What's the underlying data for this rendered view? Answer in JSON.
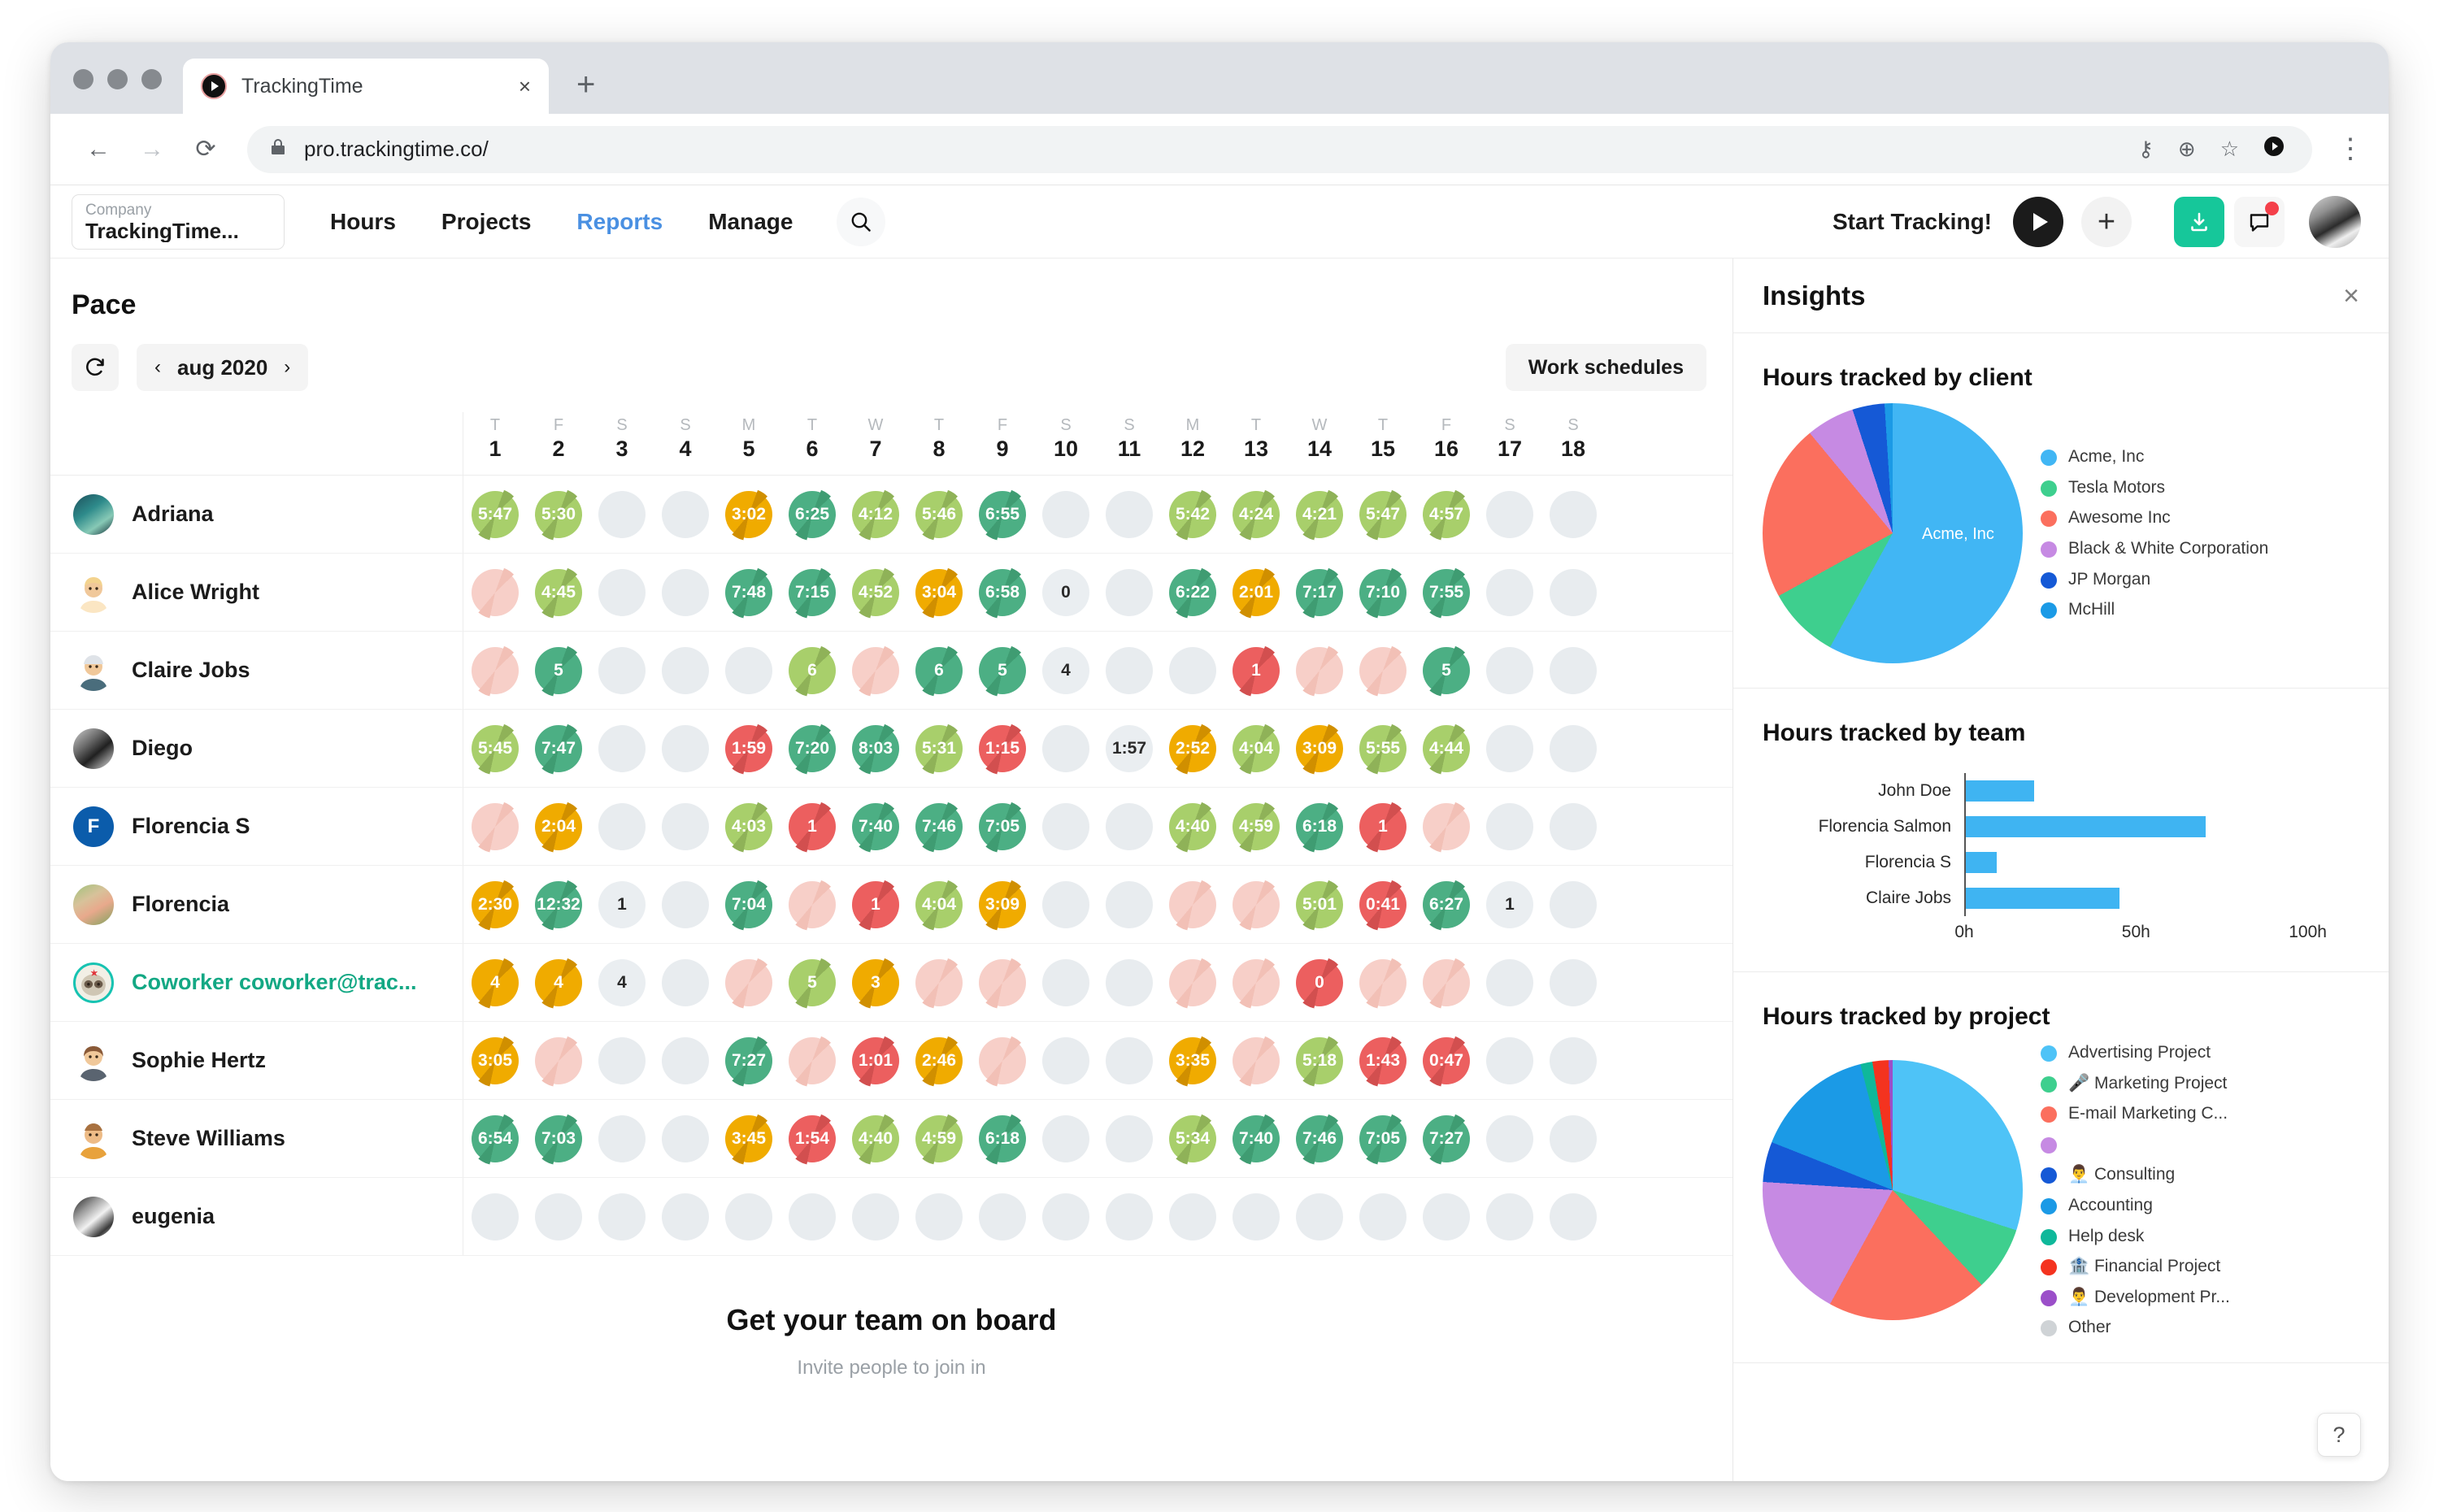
{
  "browser": {
    "tab_title": "TrackingTime",
    "tab_close": "×",
    "new_tab": "+",
    "back": "←",
    "forward": "→",
    "reload": "⟳",
    "lock": "🔒",
    "url": "pro.trackingtime.co/",
    "omni_key_icon": "⚷",
    "omni_zoom_icon": "⊕",
    "omni_star_icon": "☆",
    "kebab": "⋮"
  },
  "header": {
    "company_label": "Company",
    "company_name": "TrackingTime...",
    "nav": [
      {
        "label": "Hours",
        "active": false
      },
      {
        "label": "Projects",
        "active": false
      },
      {
        "label": "Reports",
        "active": true
      },
      {
        "label": "Manage",
        "active": false
      }
    ],
    "search_icon": "search-icon",
    "start_tracking": "Start Tracking!",
    "plus": "+"
  },
  "pace": {
    "title": "Pace",
    "date_label": "aug 2020",
    "prev": "‹",
    "next": "›",
    "work_schedules": "Work schedules",
    "days": [
      {
        "dow": "T",
        "num": "1"
      },
      {
        "dow": "F",
        "num": "2"
      },
      {
        "dow": "S",
        "num": "3"
      },
      {
        "dow": "S",
        "num": "4"
      },
      {
        "dow": "M",
        "num": "5"
      },
      {
        "dow": "T",
        "num": "6"
      },
      {
        "dow": "W",
        "num": "7"
      },
      {
        "dow": "T",
        "num": "8"
      },
      {
        "dow": "F",
        "num": "9"
      },
      {
        "dow": "S",
        "num": "10"
      },
      {
        "dow": "S",
        "num": "11"
      },
      {
        "dow": "M",
        "num": "12"
      },
      {
        "dow": "T",
        "num": "13"
      },
      {
        "dow": "W",
        "num": "14"
      },
      {
        "dow": "T",
        "num": "15"
      },
      {
        "dow": "F",
        "num": "16"
      },
      {
        "dow": "S",
        "num": "17"
      },
      {
        "dow": "S",
        "num": "18"
      }
    ],
    "colors": {
      "empty": "#e8ecef",
      "green_dark": "#4caf84",
      "green_light": "#a8cf6b",
      "amber": "#f0ab00",
      "red": "#ec5f5f",
      "pink": "#f7cfc8"
    },
    "rows": [
      {
        "name": "Adriana",
        "selected": false,
        "avatar": "photo-teal",
        "cells": [
          {
            "v": "5:47",
            "c": "green_light"
          },
          {
            "v": "5:30",
            "c": "green_light"
          },
          {
            "v": "",
            "c": "empty"
          },
          {
            "v": "",
            "c": "empty"
          },
          {
            "v": "3:02",
            "c": "amber"
          },
          {
            "v": "6:25",
            "c": "green_dark"
          },
          {
            "v": "4:12",
            "c": "green_light"
          },
          {
            "v": "5:46",
            "c": "green_light"
          },
          {
            "v": "6:55",
            "c": "green_dark"
          },
          {
            "v": "",
            "c": "empty"
          },
          {
            "v": "",
            "c": "empty"
          },
          {
            "v": "5:42",
            "c": "green_light"
          },
          {
            "v": "4:24",
            "c": "green_light"
          },
          {
            "v": "4:21",
            "c": "green_light"
          },
          {
            "v": "5:47",
            "c": "green_light"
          },
          {
            "v": "4:57",
            "c": "green_light"
          },
          {
            "v": "",
            "c": "empty"
          },
          {
            "v": "",
            "c": "empty"
          }
        ]
      },
      {
        "name": "Alice Wright",
        "selected": false,
        "avatar": "woman-earrings",
        "cells": [
          {
            "v": "",
            "c": "pink"
          },
          {
            "v": "4:45",
            "c": "green_light"
          },
          {
            "v": "",
            "c": "empty"
          },
          {
            "v": "",
            "c": "empty"
          },
          {
            "v": "7:48",
            "c": "green_dark"
          },
          {
            "v": "7:15",
            "c": "green_dark"
          },
          {
            "v": "4:52",
            "c": "green_light"
          },
          {
            "v": "3:04",
            "c": "amber"
          },
          {
            "v": "6:58",
            "c": "green_dark"
          },
          {
            "v": "0",
            "c": "plain"
          },
          {
            "v": "",
            "c": "empty"
          },
          {
            "v": "6:22",
            "c": "green_dark"
          },
          {
            "v": "2:01",
            "c": "amber"
          },
          {
            "v": "7:17",
            "c": "green_dark"
          },
          {
            "v": "7:10",
            "c": "green_dark"
          },
          {
            "v": "7:55",
            "c": "green_dark"
          },
          {
            "v": "",
            "c": "empty"
          },
          {
            "v": "",
            "c": "empty"
          }
        ]
      },
      {
        "name": "Claire Jobs",
        "selected": false,
        "avatar": "woman-bandana",
        "cells": [
          {
            "v": "",
            "c": "pink"
          },
          {
            "v": "5",
            "c": "green_dark"
          },
          {
            "v": "",
            "c": "empty"
          },
          {
            "v": "",
            "c": "empty"
          },
          {
            "v": "",
            "c": "empty"
          },
          {
            "v": "6",
            "c": "green_light"
          },
          {
            "v": "",
            "c": "pink"
          },
          {
            "v": "6",
            "c": "green_dark"
          },
          {
            "v": "5",
            "c": "green_dark"
          },
          {
            "v": "4",
            "c": "plain"
          },
          {
            "v": "",
            "c": "empty"
          },
          {
            "v": "",
            "c": "empty"
          },
          {
            "v": "1",
            "c": "red"
          },
          {
            "v": "",
            "c": "pink"
          },
          {
            "v": "",
            "c": "pink"
          },
          {
            "v": "5",
            "c": "green_dark"
          },
          {
            "v": "",
            "c": "empty"
          },
          {
            "v": "",
            "c": "empty"
          }
        ]
      },
      {
        "name": "Diego",
        "selected": false,
        "avatar": "man-gray",
        "cells": [
          {
            "v": "5:45",
            "c": "green_light"
          },
          {
            "v": "7:47",
            "c": "green_dark"
          },
          {
            "v": "",
            "c": "empty"
          },
          {
            "v": "",
            "c": "empty"
          },
          {
            "v": "1:59",
            "c": "red"
          },
          {
            "v": "7:20",
            "c": "green_dark"
          },
          {
            "v": "8:03",
            "c": "green_dark"
          },
          {
            "v": "5:31",
            "c": "green_light"
          },
          {
            "v": "1:15",
            "c": "red"
          },
          {
            "v": "",
            "c": "empty"
          },
          {
            "v": "1:57",
            "c": "plain"
          },
          {
            "v": "2:52",
            "c": "amber"
          },
          {
            "v": "4:04",
            "c": "green_light"
          },
          {
            "v": "3:09",
            "c": "amber"
          },
          {
            "v": "5:55",
            "c": "green_light"
          },
          {
            "v": "4:44",
            "c": "green_light"
          },
          {
            "v": "",
            "c": "empty"
          },
          {
            "v": "",
            "c": "empty"
          }
        ]
      },
      {
        "name": "Florencia S",
        "selected": false,
        "avatar": "initial-F",
        "cells": [
          {
            "v": "",
            "c": "pink"
          },
          {
            "v": "2:04",
            "c": "amber"
          },
          {
            "v": "",
            "c": "empty"
          },
          {
            "v": "",
            "c": "empty"
          },
          {
            "v": "4:03",
            "c": "green_light"
          },
          {
            "v": "1",
            "c": "red"
          },
          {
            "v": "7:40",
            "c": "green_dark"
          },
          {
            "v": "7:46",
            "c": "green_dark"
          },
          {
            "v": "7:05",
            "c": "green_dark"
          },
          {
            "v": "",
            "c": "empty"
          },
          {
            "v": "",
            "c": "empty"
          },
          {
            "v": "4:40",
            "c": "green_light"
          },
          {
            "v": "4:59",
            "c": "green_light"
          },
          {
            "v": "6:18",
            "c": "green_dark"
          },
          {
            "v": "1",
            "c": "red"
          },
          {
            "v": "",
            "c": "pink"
          },
          {
            "v": "",
            "c": "empty"
          },
          {
            "v": "",
            "c": "empty"
          }
        ]
      },
      {
        "name": "Florencia",
        "selected": false,
        "avatar": "photo-woman-hat",
        "cells": [
          {
            "v": "2:30",
            "c": "amber"
          },
          {
            "v": "12:32",
            "c": "green_dark"
          },
          {
            "v": "1",
            "c": "plain"
          },
          {
            "v": "",
            "c": "empty"
          },
          {
            "v": "7:04",
            "c": "green_dark"
          },
          {
            "v": "",
            "c": "pink"
          },
          {
            "v": "1",
            "c": "red"
          },
          {
            "v": "4:04",
            "c": "green_light"
          },
          {
            "v": "3:09",
            "c": "amber"
          },
          {
            "v": "",
            "c": "empty"
          },
          {
            "v": "",
            "c": "empty"
          },
          {
            "v": "",
            "c": "pink"
          },
          {
            "v": "",
            "c": "pink"
          },
          {
            "v": "5:01",
            "c": "green_light"
          },
          {
            "v": "0:41",
            "c": "red"
          },
          {
            "v": "6:27",
            "c": "green_dark"
          },
          {
            "v": "1",
            "c": "plain"
          },
          {
            "v": "",
            "c": "empty"
          }
        ]
      },
      {
        "name": "Coworker coworker@trac...",
        "selected": true,
        "avatar": "sloth-teal",
        "cells": [
          {
            "v": "4",
            "c": "amber"
          },
          {
            "v": "4",
            "c": "amber"
          },
          {
            "v": "4",
            "c": "plain"
          },
          {
            "v": "",
            "c": "empty"
          },
          {
            "v": "",
            "c": "pink"
          },
          {
            "v": "5",
            "c": "green_light"
          },
          {
            "v": "3",
            "c": "amber"
          },
          {
            "v": "",
            "c": "pink"
          },
          {
            "v": "",
            "c": "pink"
          },
          {
            "v": "",
            "c": "empty"
          },
          {
            "v": "",
            "c": "empty"
          },
          {
            "v": "",
            "c": "pink"
          },
          {
            "v": "",
            "c": "pink"
          },
          {
            "v": "0",
            "c": "red"
          },
          {
            "v": "",
            "c": "pink"
          },
          {
            "v": "",
            "c": "pink"
          },
          {
            "v": "",
            "c": "empty"
          },
          {
            "v": "",
            "c": "empty"
          }
        ]
      },
      {
        "name": "Sophie Hertz",
        "selected": false,
        "avatar": "woman-brown-hair",
        "cells": [
          {
            "v": "3:05",
            "c": "amber"
          },
          {
            "v": "",
            "c": "pink"
          },
          {
            "v": "",
            "c": "empty"
          },
          {
            "v": "",
            "c": "empty"
          },
          {
            "v": "7:27",
            "c": "green_dark"
          },
          {
            "v": "",
            "c": "pink"
          },
          {
            "v": "1:01",
            "c": "red"
          },
          {
            "v": "2:46",
            "c": "amber"
          },
          {
            "v": "",
            "c": "pink"
          },
          {
            "v": "",
            "c": "empty"
          },
          {
            "v": "",
            "c": "empty"
          },
          {
            "v": "3:35",
            "c": "amber"
          },
          {
            "v": "",
            "c": "pink"
          },
          {
            "v": "5:18",
            "c": "green_light"
          },
          {
            "v": "1:43",
            "c": "red"
          },
          {
            "v": "0:47",
            "c": "red"
          },
          {
            "v": "",
            "c": "empty"
          },
          {
            "v": "",
            "c": "empty"
          }
        ]
      },
      {
        "name": "Steve Williams",
        "selected": false,
        "avatar": "man-beard",
        "cells": [
          {
            "v": "6:54",
            "c": "green_dark"
          },
          {
            "v": "7:03",
            "c": "green_dark"
          },
          {
            "v": "",
            "c": "empty"
          },
          {
            "v": "",
            "c": "empty"
          },
          {
            "v": "3:45",
            "c": "amber"
          },
          {
            "v": "1:54",
            "c": "red"
          },
          {
            "v": "4:40",
            "c": "green_light"
          },
          {
            "v": "4:59",
            "c": "green_light"
          },
          {
            "v": "6:18",
            "c": "green_dark"
          },
          {
            "v": "",
            "c": "empty"
          },
          {
            "v": "",
            "c": "empty"
          },
          {
            "v": "5:34",
            "c": "green_light"
          },
          {
            "v": "7:40",
            "c": "green_dark"
          },
          {
            "v": "7:46",
            "c": "green_dark"
          },
          {
            "v": "7:05",
            "c": "green_dark"
          },
          {
            "v": "7:27",
            "c": "green_dark"
          },
          {
            "v": "",
            "c": "empty"
          },
          {
            "v": "",
            "c": "empty"
          }
        ]
      },
      {
        "name": "eugenia",
        "selected": false,
        "avatar": "photo-bw",
        "cells": [
          {
            "v": "",
            "c": "empty"
          },
          {
            "v": "",
            "c": "empty"
          },
          {
            "v": "",
            "c": "empty"
          },
          {
            "v": "",
            "c": "empty"
          },
          {
            "v": "",
            "c": "empty"
          },
          {
            "v": "",
            "c": "empty"
          },
          {
            "v": "",
            "c": "empty"
          },
          {
            "v": "",
            "c": "empty"
          },
          {
            "v": "",
            "c": "empty"
          },
          {
            "v": "",
            "c": "empty"
          },
          {
            "v": "",
            "c": "empty"
          },
          {
            "v": "",
            "c": "empty"
          },
          {
            "v": "",
            "c": "empty"
          },
          {
            "v": "",
            "c": "empty"
          },
          {
            "v": "",
            "c": "empty"
          },
          {
            "v": "",
            "c": "empty"
          },
          {
            "v": "",
            "c": "empty"
          },
          {
            "v": "",
            "c": "empty"
          }
        ]
      }
    ]
  },
  "onboard": {
    "title": "Get your team on board",
    "subtitle": "Invite people to join in"
  },
  "insights": {
    "title": "Insights",
    "close": "×",
    "help": "?"
  },
  "chart_data": [
    {
      "type": "pie",
      "title": "Hours tracked by client",
      "legend_position": "right",
      "inline_label": "Acme, Inc",
      "categories": [
        "Acme, Inc",
        "Tesla Motors",
        "Awesome Inc",
        "Black & White Corporation",
        "JP Morgan",
        "McHill"
      ],
      "values": [
        58,
        9,
        22,
        6,
        4,
        1
      ],
      "colors": [
        "#41b6f4",
        "#3ecf8e",
        "#fb6f5e",
        "#c68ae3",
        "#1559d6",
        "#1b9ae6"
      ]
    },
    {
      "type": "bar",
      "title": "Hours tracked by team",
      "orientation": "horizontal",
      "categories": [
        "John Doe",
        "Florencia Salmon",
        "Florencia S",
        "Claire Jobs"
      ],
      "values": [
        20,
        70,
        9,
        45
      ],
      "xlabel": "",
      "ylabel": "",
      "xlim": [
        0,
        115
      ],
      "ticks": [
        "0h",
        "50h",
        "100h"
      ],
      "tick_values": [
        0,
        50,
        100
      ],
      "bar_color": "#3fb4f2",
      "grid": false
    },
    {
      "type": "pie",
      "title": "Hours tracked by project",
      "legend_position": "right",
      "categories": [
        "Advertising Project",
        "🎤 Marketing Project",
        "E-mail Marketing C...",
        "",
        "👨‍💼 Consulting",
        "Accounting",
        "Help desk",
        "🏦 Financial Project",
        "👨‍💼 Development Pr...",
        "Other"
      ],
      "values": [
        30,
        8,
        20,
        18,
        5,
        15,
        1.5,
        2,
        0.5,
        0
      ],
      "colors": [
        "#4ec3f7",
        "#3ecf8e",
        "#fb6f5e",
        "#c68ae3",
        "#1559d6",
        "#1b9ae6",
        "#0fb89a",
        "#f4331f",
        "#9b4fc9",
        "#cfd3d6"
      ]
    }
  ]
}
